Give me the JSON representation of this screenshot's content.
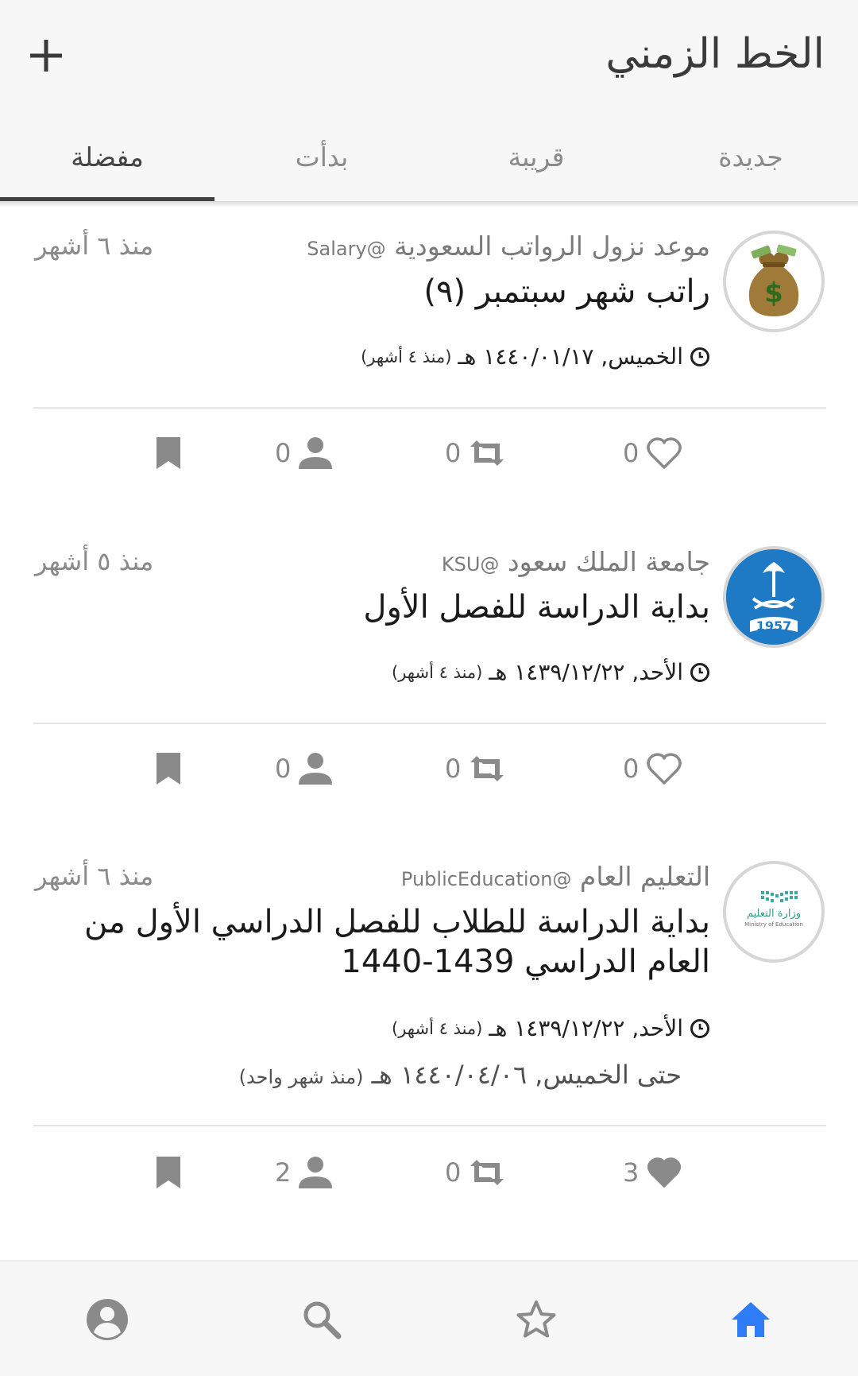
{
  "header": {
    "title": "الخط الزمني",
    "add_icon": "plus-icon"
  },
  "tabs": [
    {
      "label": "جديدة",
      "active": false
    },
    {
      "label": "قريبة",
      "active": false
    },
    {
      "label": "بدأت",
      "active": false
    },
    {
      "label": "مفضلة",
      "active": true
    }
  ],
  "posts": [
    {
      "author": "موعد نزول الرواتب السعودية",
      "handle": "@Salary",
      "ago": "منذ ٦ أشهر",
      "title": "راتب شهر سبتمبر (٩)",
      "date": "الخميس, ١٤٤٠/٠١/١٧ هـ",
      "date_ago": "(منذ ٤ أشهر)",
      "avatar_icon": "money-bag-avatar",
      "likes": "0",
      "retweets": "0",
      "attendees": "0",
      "liked": false
    },
    {
      "author": "جامعة الملك سعود",
      "handle": "@KSU",
      "ago": "منذ ٥ أشهر",
      "title": "بداية الدراسة للفصل الأول",
      "date": "الأحد, ١٤٣٩/١٢/٢٢ هـ",
      "date_ago": "(منذ ٤ أشهر)",
      "avatar_icon": "ksu-logo-avatar",
      "avatar_text": "1957",
      "likes": "0",
      "retweets": "0",
      "attendees": "0",
      "liked": false
    },
    {
      "author": "التعليم العام",
      "handle": "@PublicEducation",
      "ago": "منذ ٦ أشهر",
      "title": "بداية الدراسة للطلاب للفصل الدراسي الأول من العام الدراسي 1439-1440",
      "date": "الأحد, ١٤٣٩/١٢/٢٢ هـ",
      "date_ago": "(منذ ٤ أشهر)",
      "until": "حتى الخميس, ١٤٤٠/٠٤/٠٦ هـ",
      "until_ago": "(منذ شهر واحد)",
      "avatar_icon": "ministry-of-education-avatar",
      "avatar_text": "وزارة التعليم",
      "avatar_subtext": "Ministry of Education",
      "likes": "3",
      "retweets": "0",
      "attendees": "2",
      "liked": true
    }
  ],
  "bottom_nav": [
    {
      "icon": "home-icon",
      "active": true
    },
    {
      "icon": "star-icon",
      "active": false
    },
    {
      "icon": "search-icon",
      "active": false
    },
    {
      "icon": "account-icon",
      "active": false
    }
  ],
  "colors": {
    "accent": "#2f7df6",
    "icon_gray": "#8a8a8a",
    "header_bg": "#f7f7f7"
  }
}
